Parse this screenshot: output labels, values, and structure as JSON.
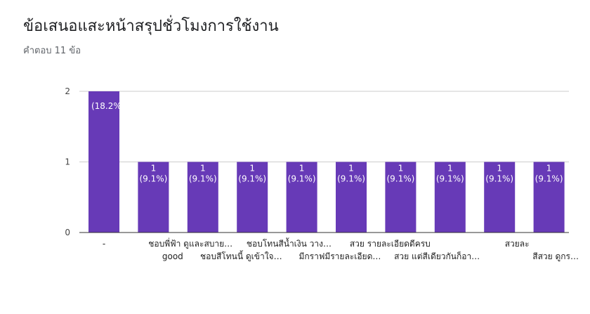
{
  "title": "ข้อเสนอแสะหน้าสรุปชั่วโมงการใช้งาน",
  "subtitle": "คำตอบ 11 ข้อ",
  "colors": {
    "bar": "#673ab7",
    "grid": "#cccccc",
    "axis": "#333333"
  },
  "chart_data": {
    "type": "bar",
    "categories": [
      "-",
      "good",
      "ชอบพี่ฟ้า ดูและสบาย…",
      "ชอบสีโทนนี้ ดูเข้าใจ…",
      "ชอบโทนสีน้ำเงิน วาง…",
      "มีกราฟมีรายละเอียด…",
      "สวย รายละเอียดดีครบ",
      "สวย แต่สีเดียวกันก็อา…",
      "สวยละ",
      "สีสวย ดูกร…"
    ],
    "values": [
      2,
      1,
      1,
      1,
      1,
      1,
      1,
      1,
      1,
      1
    ],
    "data_labels": [
      [
        "2 (18.2%)"
      ],
      [
        "1",
        "(9.1%)"
      ],
      [
        "1",
        "(9.1%)"
      ],
      [
        "1",
        "(9.1%)"
      ],
      [
        "1",
        "(9.1%)"
      ],
      [
        "1",
        "(9.1%)"
      ],
      [
        "1",
        "(9.1%)"
      ],
      [
        "1",
        "(9.1%)"
      ],
      [
        "1",
        "(9.1%)"
      ],
      [
        "1",
        "(9.1%)"
      ]
    ],
    "y_ticks": [
      0,
      1,
      2
    ],
    "ylim": [
      0,
      2
    ],
    "grid": true,
    "legend": "none"
  }
}
